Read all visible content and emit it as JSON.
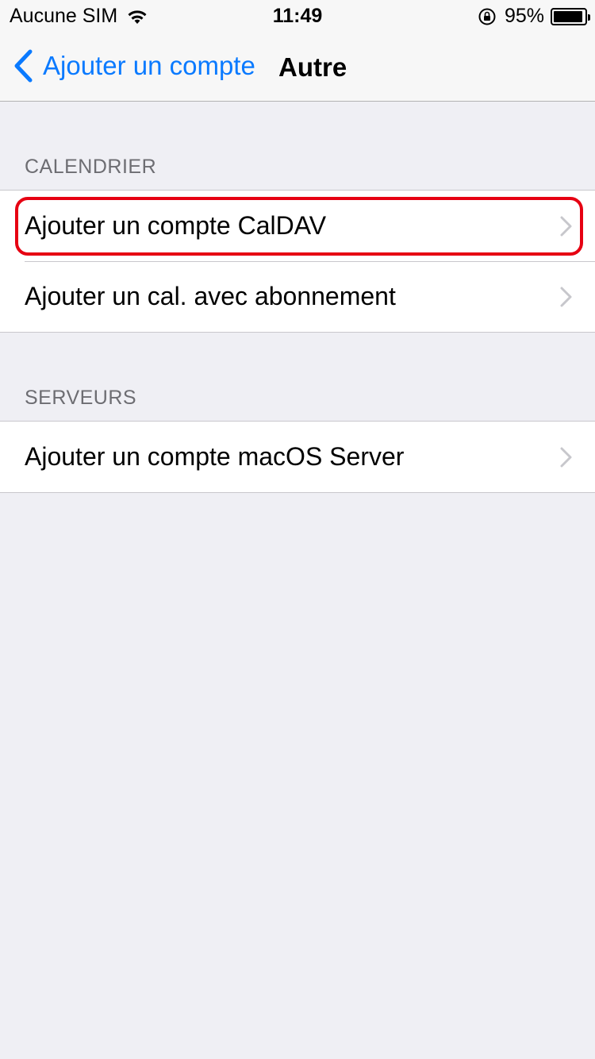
{
  "status_bar": {
    "carrier": "Aucune SIM",
    "time": "11:49",
    "battery_percent": "95%",
    "battery_level": 0.95
  },
  "nav": {
    "back_label": "Ajouter un compte",
    "title": "Autre"
  },
  "sections": {
    "calendar": {
      "header": "CALENDRIER",
      "items": [
        {
          "label": "Ajouter un compte CalDAV"
        },
        {
          "label": "Ajouter un cal. avec abonnement"
        }
      ]
    },
    "servers": {
      "header": "SERVEURS",
      "items": [
        {
          "label": "Ajouter un compte macOS Server"
        }
      ]
    }
  },
  "colors": {
    "accent": "#0a7aff",
    "background": "#efeff4",
    "highlight": "#e60012"
  }
}
